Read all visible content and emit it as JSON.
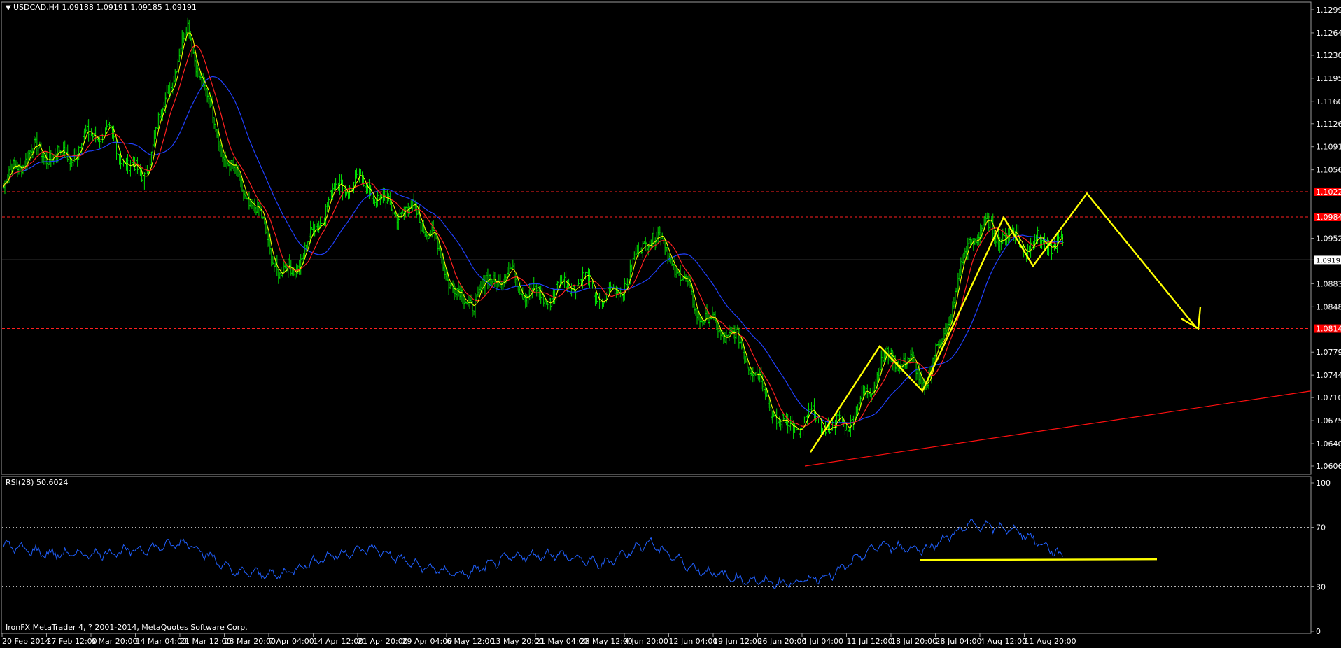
{
  "main_chart": {
    "symbol_header": "USDCAD,H4  1.09188 1.09191 1.09185 1.09191",
    "y_ticks": [
      "1.12990",
      "1.12640",
      "1.12300",
      "1.11950",
      "1.11600",
      "1.11260",
      "1.10910",
      "1.10560",
      "1.10227",
      "1.09844",
      "1.09520",
      "1.09191",
      "1.08830",
      "1.08480",
      "1.08148",
      "1.07790",
      "1.07440",
      "1.07100",
      "1.06750",
      "1.06400",
      "1.06060"
    ],
    "current_price": "1.09191",
    "level_lines": [
      "1.10227",
      "1.09844",
      "1.08148"
    ],
    "colors": {
      "candles": "#00e000",
      "ma_fast": "#ff2020",
      "ma_slow": "#2040ff",
      "ma_price": "#ffff00",
      "level": "#ff2020",
      "trendline": "#ff1010",
      "zigzag": "#ffff00",
      "current_line": "#c0c0c0"
    }
  },
  "rsi_panel": {
    "header": "RSI(28) 50.6024",
    "y_ticks": [
      "100",
      "70",
      "30",
      "0"
    ],
    "color": "#2060ff"
  },
  "x_ticks": [
    "20 Feb 2014",
    "27 Feb 12:00",
    "6 Mar 20:00",
    "14 Mar 04:00",
    "21 Mar 12:00",
    "28 Mar 20:00",
    "7 Apr 04:00",
    "14 Apr 12:00",
    "21 Apr 20:00",
    "29 Apr 04:00",
    "6 May 12:00",
    "13 May 20:00",
    "21 May 04:00",
    "28 May 12:00",
    "4 Jun 20:00",
    "12 Jun 04:00",
    "19 Jun 12:00",
    "26 Jun 20:00",
    "4 Jul 04:00",
    "11 Jul 12:00",
    "18 Jul 20:00",
    "28 Jul 04:00",
    "4 Aug 12:00",
    "11 Aug 20:00"
  ],
  "footer": "IronFX MetaTrader 4, ? 2001-2014, MetaQuotes Software Corp.",
  "chart_data": {
    "type": "line",
    "title": "USDCAD,H4",
    "series": [
      {
        "name": "USDCAD,H4",
        "x": [
          "20 Feb 2014",
          "27 Feb 12:00",
          "6 Mar 20:00",
          "14 Mar 04:00",
          "21 Mar 12:00",
          "28 Mar 20:00",
          "7 Apr 04:00",
          "14 Apr 12:00",
          "21 Apr 20:00",
          "29 Apr 04:00",
          "6 May 12:00",
          "13 May 20:00",
          "21 May 04:00",
          "28 May 12:00",
          "4 Jun 20:00",
          "12 Jun 04:00",
          "19 Jun 12:00",
          "26 Jun 20:00",
          "4 Jul 04:00",
          "11 Jul 12:00",
          "18 Jul 20:00",
          "28 Jul 04:00",
          "4 Aug 12:00",
          "11 Aug 20:00"
        ],
        "values": [
          1.103,
          1.109,
          1.11,
          1.106,
          1.125,
          1.106,
          1.089,
          1.1,
          1.104,
          1.097,
          1.087,
          1.088,
          1.088,
          1.086,
          1.095,
          1.087,
          1.077,
          1.068,
          1.065,
          1.076,
          1.074,
          1.094,
          1.097,
          1.0919
        ]
      },
      {
        "name": "RSI(28)",
        "x": [
          "20 Feb 2014",
          "27 Feb 12:00",
          "6 Mar 20:00",
          "14 Mar 04:00",
          "21 Mar 12:00",
          "28 Mar 20:00",
          "7 Apr 04:00",
          "14 Apr 12:00",
          "21 Apr 20:00",
          "29 Apr 04:00",
          "6 May 12:00",
          "13 May 20:00",
          "21 May 04:00",
          "28 May 12:00",
          "4 Jun 20:00",
          "12 Jun 04:00",
          "19 Jun 12:00",
          "26 Jun 20:00",
          "4 Jul 04:00",
          "11 Jul 12:00",
          "18 Jul 20:00",
          "28 Jul 04:00",
          "4 Aug 12:00",
          "11 Aug 20:00"
        ],
        "values": [
          58,
          52,
          52,
          55,
          60,
          40,
          38,
          50,
          56,
          44,
          38,
          50,
          52,
          45,
          60,
          42,
          35,
          32,
          38,
          58,
          55,
          72,
          68,
          50.6
        ]
      }
    ],
    "ylim_main": [
      1.0606,
      1.1299
    ],
    "ylim_rsi": [
      0,
      100
    ],
    "grid": false
  }
}
